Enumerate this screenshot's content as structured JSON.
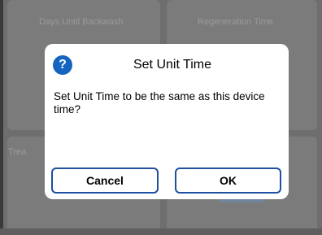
{
  "background": {
    "card_labels": {
      "days_until_backwash": "Days Until Backwash",
      "regeneration_time": "Regeneration Time",
      "treated": "Trea"
    }
  },
  "dialog": {
    "icon": "question-circle-icon",
    "icon_glyph": "?",
    "title": "Set Unit Time",
    "message": "Set Unit Time to be the same as this device time?",
    "cancel_label": "Cancel",
    "ok_label": "OK"
  },
  "colors": {
    "accent": "#1e4fa0",
    "icon": "#1565c0",
    "overlay": "#6e6e6e"
  }
}
